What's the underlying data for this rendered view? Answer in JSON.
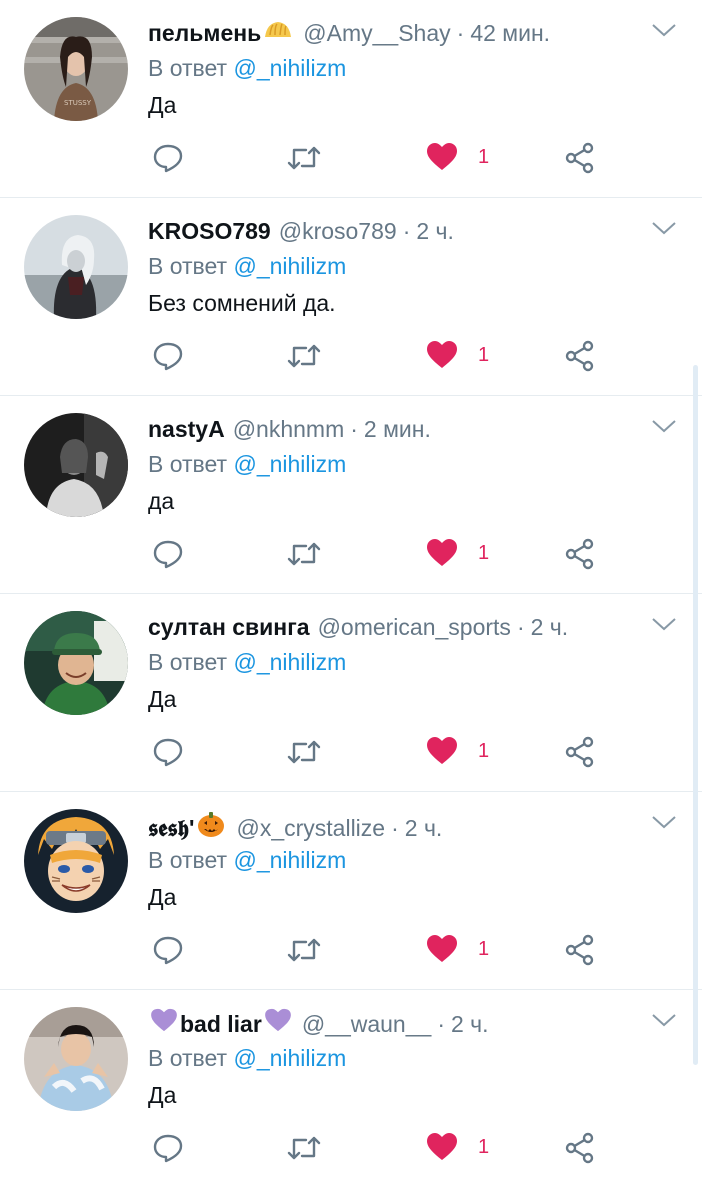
{
  "accent": "#1b95e0",
  "like_color": "#e0245e",
  "muted": "#657786",
  "tweets": [
    {
      "name": "пельмень",
      "name_emoji_after": "dumpling-icon",
      "handle": "@Amy__Shay",
      "sep": "·",
      "time": "42 мин.",
      "reply_prefix": "В ответ",
      "reply_to": "@_nihilizm",
      "text": "Да",
      "likes": "1",
      "avatar": "girl-brown-shirt"
    },
    {
      "name": "KROSO789",
      "handle": "@kroso789",
      "sep": "·",
      "time": "2 ч.",
      "reply_prefix": "В ответ",
      "reply_to": "@_nihilizm",
      "text": "Без сомнений да.",
      "likes": "1",
      "avatar": "anime-dark"
    },
    {
      "name": "nastyA",
      "handle": "@nkhnmm",
      "sep": "·",
      "time": "2 мин.",
      "reply_prefix": "В ответ",
      "reply_to": "@_nihilizm",
      "text": "да",
      "likes": "1",
      "avatar": "bw-photo"
    },
    {
      "name": "султан свинга",
      "handle": "@omerican_sports",
      "sep": "·",
      "time": "2 ч.",
      "reply_prefix": "В ответ",
      "reply_to": "@_nihilizm",
      "text": "Да",
      "likes": "1",
      "avatar": "guy-green-hat"
    },
    {
      "name": "𝖘𝖊𝖘𝖍'",
      "name_emoji_after": "pumpkin-icon",
      "handle": "@x_crystallize",
      "sep": "·",
      "time": "2 ч.",
      "reply_prefix": "В ответ",
      "reply_to": "@_nihilizm",
      "text": "Да",
      "likes": "1",
      "avatar": "anime-naruto"
    },
    {
      "name_emoji_before": "purple-heart-icon",
      "name": "bad liar",
      "name_emoji_after": "purple-heart-icon",
      "handle": "@__waun__",
      "sep": "·",
      "time": "2 ч.",
      "reply_prefix": "В ответ",
      "reply_to": "@_nihilizm",
      "text": "Да",
      "likes": "1",
      "avatar": "girl-tiedye"
    }
  ]
}
